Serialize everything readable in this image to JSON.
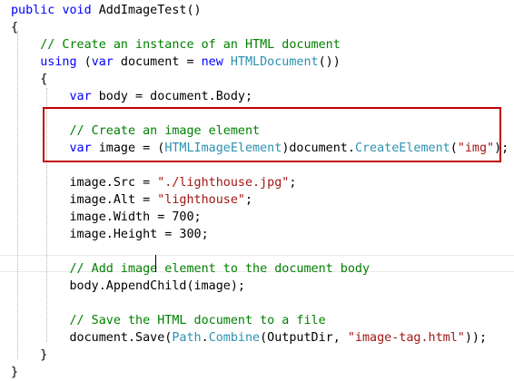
{
  "colors": {
    "keyword": "#0000ff",
    "type": "#2b91af",
    "comment": "#008000",
    "string": "#a31515",
    "plain": "#000000",
    "highlight_border": "#c00000"
  },
  "code": {
    "lines": [
      [
        {
          "t": "kw",
          "v": "public"
        },
        {
          "t": "plain",
          "v": " "
        },
        {
          "t": "kw",
          "v": "void"
        },
        {
          "t": "plain",
          "v": " AddImageTest()"
        }
      ],
      [
        {
          "t": "plain",
          "v": "{"
        }
      ],
      [
        {
          "t": "plain",
          "v": "    "
        },
        {
          "t": "comment",
          "v": "// Create an instance of an HTML document"
        }
      ],
      [
        {
          "t": "plain",
          "v": "    "
        },
        {
          "t": "kw",
          "v": "using"
        },
        {
          "t": "plain",
          "v": " ("
        },
        {
          "t": "kw",
          "v": "var"
        },
        {
          "t": "plain",
          "v": " document = "
        },
        {
          "t": "kw",
          "v": "new"
        },
        {
          "t": "plain",
          "v": " "
        },
        {
          "t": "type",
          "v": "HTMLDocument"
        },
        {
          "t": "plain",
          "v": "())"
        }
      ],
      [
        {
          "t": "plain",
          "v": "    {"
        }
      ],
      [
        {
          "t": "plain",
          "v": "        "
        },
        {
          "t": "kw",
          "v": "var"
        },
        {
          "t": "plain",
          "v": " body = document.Body;"
        }
      ],
      [],
      [
        {
          "t": "plain",
          "v": "        "
        },
        {
          "t": "comment",
          "v": "// Create an image element"
        }
      ],
      [
        {
          "t": "plain",
          "v": "        "
        },
        {
          "t": "kw",
          "v": "var"
        },
        {
          "t": "plain",
          "v": " image = ("
        },
        {
          "t": "type",
          "v": "HTMLImageElement"
        },
        {
          "t": "plain",
          "v": ")document."
        },
        {
          "t": "type",
          "v": "CreateElement"
        },
        {
          "t": "plain",
          "v": "("
        },
        {
          "t": "string",
          "v": "\"img\""
        },
        {
          "t": "plain",
          "v": ");"
        }
      ],
      [],
      [
        {
          "t": "plain",
          "v": "        image.Src = "
        },
        {
          "t": "string",
          "v": "\"./lighthouse.jpg\""
        },
        {
          "t": "plain",
          "v": ";"
        }
      ],
      [
        {
          "t": "plain",
          "v": "        image.Alt = "
        },
        {
          "t": "string",
          "v": "\"lighthouse\""
        },
        {
          "t": "plain",
          "v": ";"
        }
      ],
      [
        {
          "t": "plain",
          "v": "        image.Width = 700;"
        }
      ],
      [
        {
          "t": "plain",
          "v": "        image.Height = 300;"
        }
      ],
      [],
      [
        {
          "t": "plain",
          "v": "        "
        },
        {
          "t": "comment",
          "v": "// Add image element to the document body"
        }
      ],
      [
        {
          "t": "plain",
          "v": "        body.AppendChild(image);"
        }
      ],
      [],
      [
        {
          "t": "plain",
          "v": "        "
        },
        {
          "t": "comment",
          "v": "// Save the HTML document to a file"
        }
      ],
      [
        {
          "t": "plain",
          "v": "        document.Save("
        },
        {
          "t": "type",
          "v": "Path"
        },
        {
          "t": "plain",
          "v": "."
        },
        {
          "t": "type",
          "v": "Combine"
        },
        {
          "t": "plain",
          "v": "(OutputDir, "
        },
        {
          "t": "string",
          "v": "\"image-tag.html\""
        },
        {
          "t": "plain",
          "v": "));"
        }
      ],
      [
        {
          "t": "plain",
          "v": "    }"
        }
      ],
      [
        {
          "t": "plain",
          "v": "}"
        }
      ]
    ]
  }
}
